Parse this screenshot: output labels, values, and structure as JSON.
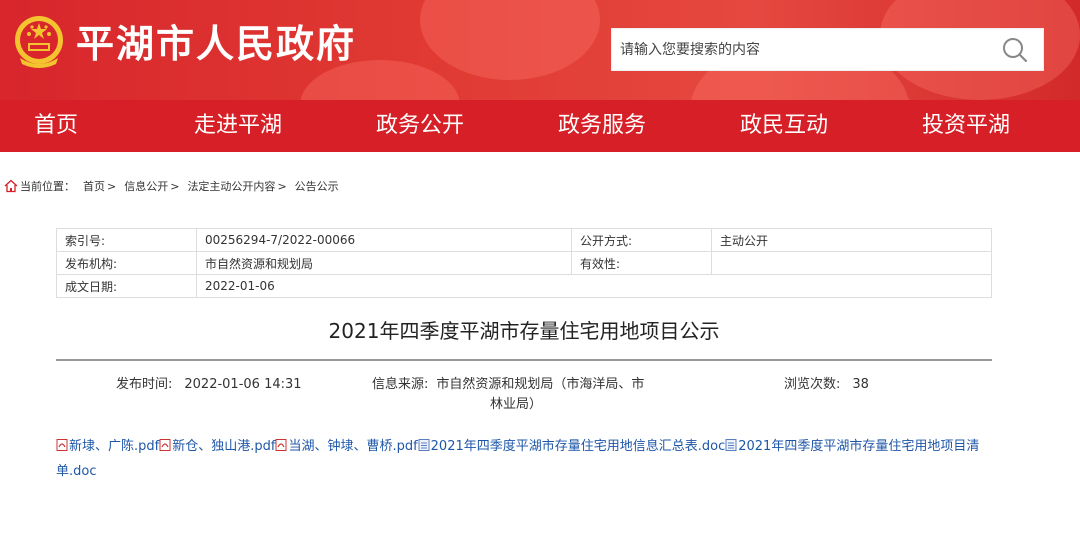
{
  "header": {
    "site_title": "平湖市人民政府",
    "search_placeholder": "请输入您要搜索的内容"
  },
  "nav": {
    "items": [
      "首页",
      "走进平湖",
      "政务公开",
      "政务服务",
      "政民互动",
      "投资平湖"
    ]
  },
  "breadcrumb": {
    "prefix": "当前位置：",
    "items": [
      "首页",
      "信息公开",
      "法定主动公开内容",
      "公告公示"
    ],
    "sep": ">"
  },
  "meta": {
    "index_label": "索引号:",
    "index_value": "00256294-7/2022-00066",
    "open_mode_label": "公开方式:",
    "open_mode_value": "主动公开",
    "issuer_label": "发布机构:",
    "issuer_value": "市自然资源和规划局",
    "validity_label": "有效性:",
    "validity_value": "",
    "date_label": "成文日期:",
    "date_value": "2022-01-06"
  },
  "article": {
    "title": "2021年四季度平湖市存量住宅用地项目公示",
    "publish_label": "发布时间:",
    "publish_value": "2022-01-06 14:31",
    "source_label": "信息来源:",
    "source_value_line1": "市自然资源和规划局（市海洋局、市",
    "source_value_line2": "林业局）",
    "views_label": "浏览次数:",
    "views_value": "38"
  },
  "attachments": [
    {
      "name": "新埭、广陈.pdf",
      "type": "pdf"
    },
    {
      "name": "新仓、独山港.pdf",
      "type": "pdf"
    },
    {
      "name": "当湖、钟埭、曹桥.pdf",
      "type": "pdf"
    },
    {
      "name": "2021年四季度平湖市存量住宅用地信息汇总表.doc",
      "type": "doc"
    },
    {
      "name": "2021年四季度平湖市存量住宅用地项目清单.doc",
      "type": "doc"
    }
  ],
  "colors": {
    "header_red": "#d8262c",
    "nav_red": "#d61f26",
    "link_blue": "#1f57a8"
  }
}
